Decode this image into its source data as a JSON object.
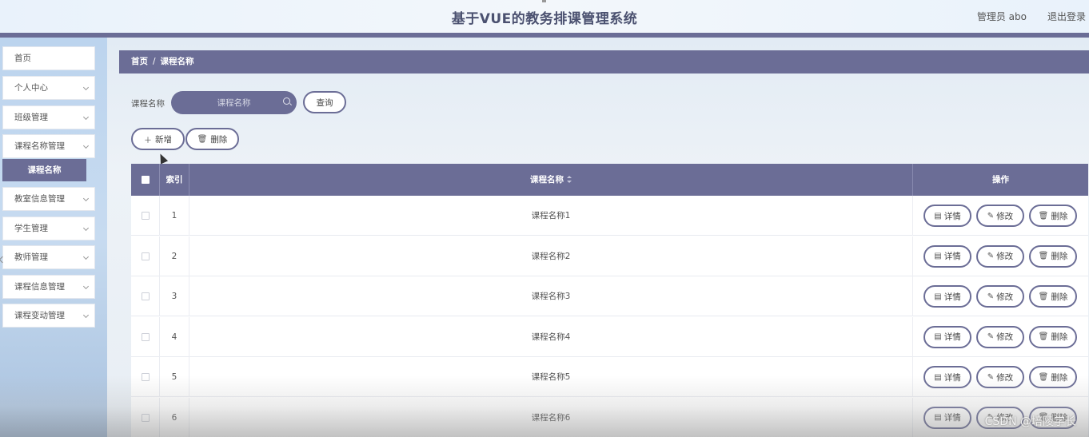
{
  "header": {
    "title": "基于VUE的教务排课管理系统",
    "user": "管理员 abo",
    "logout": "退出登录"
  },
  "sidebar": {
    "items": [
      {
        "label": "首页",
        "has_chevron": false
      },
      {
        "label": "个人中心",
        "has_chevron": true
      },
      {
        "label": "班级管理",
        "has_chevron": true
      },
      {
        "label": "课程名称管理",
        "has_chevron": true
      },
      {
        "label": "教室信息管理",
        "has_chevron": true
      },
      {
        "label": "学生管理",
        "has_chevron": true
      },
      {
        "label": "教师管理",
        "has_chevron": true
      },
      {
        "label": "课程信息管理",
        "has_chevron": true
      },
      {
        "label": "课程变动管理",
        "has_chevron": true
      }
    ],
    "active_submenu": "课程名称"
  },
  "breadcrumb": {
    "home": "首页",
    "separator": "/",
    "current": "课程名称"
  },
  "search": {
    "label": "课程名称",
    "placeholder": "课程名称",
    "query_button": "查询"
  },
  "toolbar": {
    "add_label": "新增",
    "delete_label": "删除"
  },
  "table": {
    "headers": {
      "index": "索引",
      "name": "课程名称",
      "actions": "操作"
    },
    "rows": [
      {
        "index": "1",
        "name": "课程名称1"
      },
      {
        "index": "2",
        "name": "课程名称2"
      },
      {
        "index": "3",
        "name": "课程名称3"
      },
      {
        "index": "4",
        "name": "课程名称4"
      },
      {
        "index": "5",
        "name": "课程名称5"
      },
      {
        "index": "6",
        "name": "课程名称6"
      }
    ],
    "actions": {
      "detail": "详情",
      "edit": "修改",
      "delete": "删除"
    }
  },
  "watermark": "CSDN @培陵学长",
  "colors": {
    "primary": "#6b6d96",
    "sidebar_bg": "#bcd4ee",
    "header_bg": "#e9f2fb"
  }
}
